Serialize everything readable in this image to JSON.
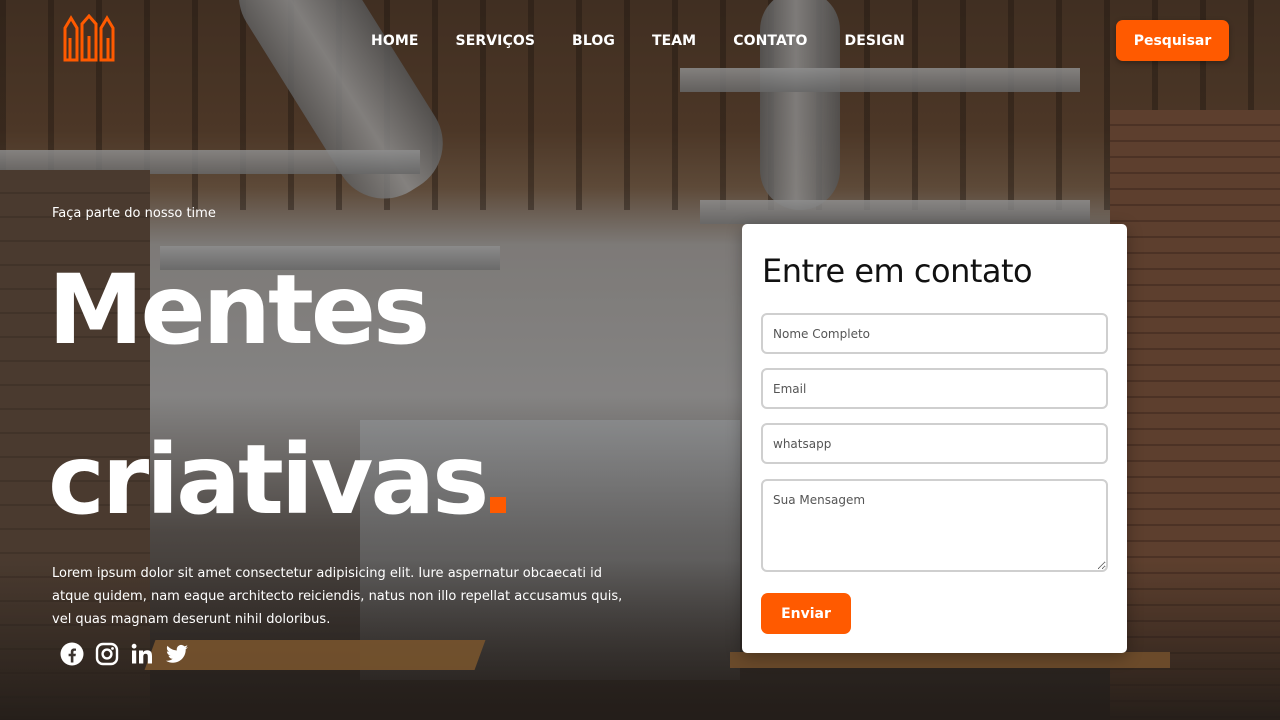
{
  "colors": {
    "accent": "#ff5a00",
    "text_light": "#ffffff",
    "card_bg": "#ffffff"
  },
  "header": {
    "logo_icon": "crown-logo-icon",
    "nav": [
      {
        "label": "HOME"
      },
      {
        "label": "SERVIÇOS"
      },
      {
        "label": "BLOG"
      },
      {
        "label": "TEAM"
      },
      {
        "label": "CONTATO"
      },
      {
        "label": "DESIGN"
      }
    ],
    "search_label": "Pesquisar"
  },
  "hero": {
    "tag": "Faça parte do nosso time",
    "title_line1": "Mentes",
    "title_line2": "criativas",
    "text": "Lorem ipsum dolor sit amet consectetur adipisicing elit. Iure aspernatur obcaecati id atque quidem, nam eaque architecto reiciendis, natus non illo repellat accusamus quis, vel quas magnam deserunt nihil doloribus.",
    "socials": [
      "facebook-icon",
      "instagram-icon",
      "linkedin-icon",
      "twitter-icon"
    ]
  },
  "contact": {
    "title": "Entre em contato",
    "name_placeholder": "Nome Completo",
    "email_placeholder": "Email",
    "whatsapp_placeholder": "whatsapp",
    "message_placeholder": "Sua Mensagem",
    "submit_label": "Enviar"
  }
}
